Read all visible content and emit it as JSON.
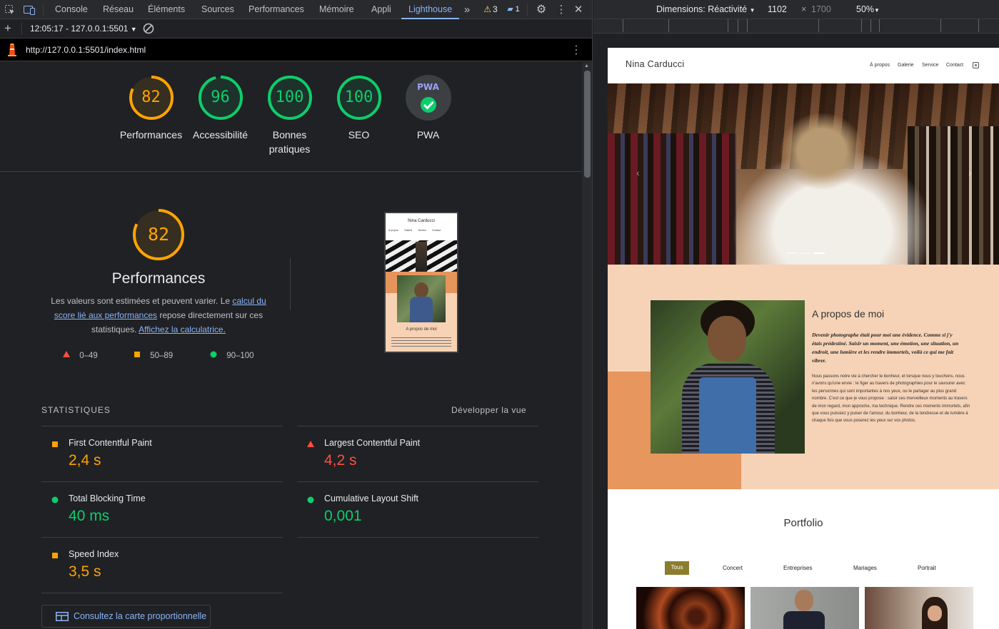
{
  "devtools": {
    "tabs": [
      "Console",
      "Réseau",
      "Éléments",
      "Sources",
      "Performances",
      "Mémoire",
      "Appli",
      "Lighthouse"
    ],
    "active_tab": "Lighthouse",
    "warnings_count": "3",
    "messages_count": "1",
    "session": "12:05:17 - 127.0.0.1:5501",
    "url": "http://127.0.0.1:5501/index.html"
  },
  "scores": [
    {
      "label": "Performances",
      "value": "82",
      "status": "average",
      "color": "#ffa400",
      "fraction": 0.82
    },
    {
      "label": "Accessibilité",
      "value": "96",
      "status": "pass",
      "color": "#0cce6b",
      "fraction": 0.96
    },
    {
      "label": "Bonnes pratiques",
      "value": "100",
      "status": "pass",
      "color": "#0cce6b",
      "fraction": 1.0
    },
    {
      "label": "SEO",
      "value": "100",
      "status": "pass",
      "color": "#0cce6b",
      "fraction": 1.0
    },
    {
      "label": "PWA",
      "value": "PWA",
      "status": "pwa",
      "color": "#5f6368",
      "fraction": 1.0
    }
  ],
  "perf_section": {
    "score": "82",
    "title": "Performances",
    "desc_1": "Les valeurs sont estimées et peuvent varier. Le ",
    "desc_link1": "calcul du score lié aux performances",
    "desc_2": " repose directement sur ces statistiques. ",
    "desc_link2": "Affichez la calculatrice.",
    "legend": [
      {
        "range": "0–49",
        "color": "#ff4e42",
        "shape": "triangle"
      },
      {
        "range": "50–89",
        "color": "#ffa400",
        "shape": "square"
      },
      {
        "range": "90–100",
        "color": "#0cce6b",
        "shape": "circle"
      }
    ]
  },
  "thumbnail": {
    "brand": "Nina Carducci",
    "nav": [
      "À propos",
      "Galerie",
      "Service",
      "Contact"
    ],
    "about_title": "A propos de moi"
  },
  "metrics_header": {
    "title": "STATISTIQUES",
    "toggle": "Développer la vue"
  },
  "metrics": [
    {
      "label": "First Contentful Paint",
      "value": "2,4 s",
      "status": "average"
    },
    {
      "label": "Largest Contentful Paint",
      "value": "4,2 s",
      "status": "fail"
    },
    {
      "label": "Total Blocking Time",
      "value": "40 ms",
      "status": "pass"
    },
    {
      "label": "Cumulative Layout Shift",
      "value": "0,001",
      "status": "pass"
    },
    {
      "label": "Speed Index",
      "value": "3,5 s",
      "status": "average"
    }
  ],
  "treemap_button": "Consultez la carte proportionnelle",
  "emulation": {
    "dimensions_label": "Dimensions: Réactivité",
    "width": "1102",
    "height": "1700",
    "zoom": "50%"
  },
  "site": {
    "brand": "Nina Carducci",
    "nav": [
      "À propos",
      "Galerie",
      "Service",
      "Contact"
    ],
    "about_title": "A propos de moi",
    "about_intro": "Devenir photographe était pour moi une évidence. Comme si j'y étais prédestiné. Saisir un moment, une émotion, une situation, un endroit, une lumière et les rendre immortels, voilà ce qui me fait vibrer.",
    "about_body": "Nous passons notre vie à chercher le bonheur, et lorsque nous y touchons, nous n'avons qu'une envie : le figer au travers de photographies pour le savourer avec les personnes qui sont importantes à nos yeux, ou le partager au plus grand nombre. C'est ce que je vous propose : saisir ces merveilleux moments au travers de mon regard, mon approche, ma technique. Rendre ces moments immortels, afin que vous puissiez y puiser de l'amour, du bonheur, de la tendresse et de lumière à chaque fois que vous poserez les yeux sur vos photos.",
    "portfolio_title": "Portfolio",
    "filters": [
      "Tous",
      "Concert",
      "Entreprises",
      "Mariages",
      "Portrait"
    ],
    "active_filter": "Tous"
  }
}
